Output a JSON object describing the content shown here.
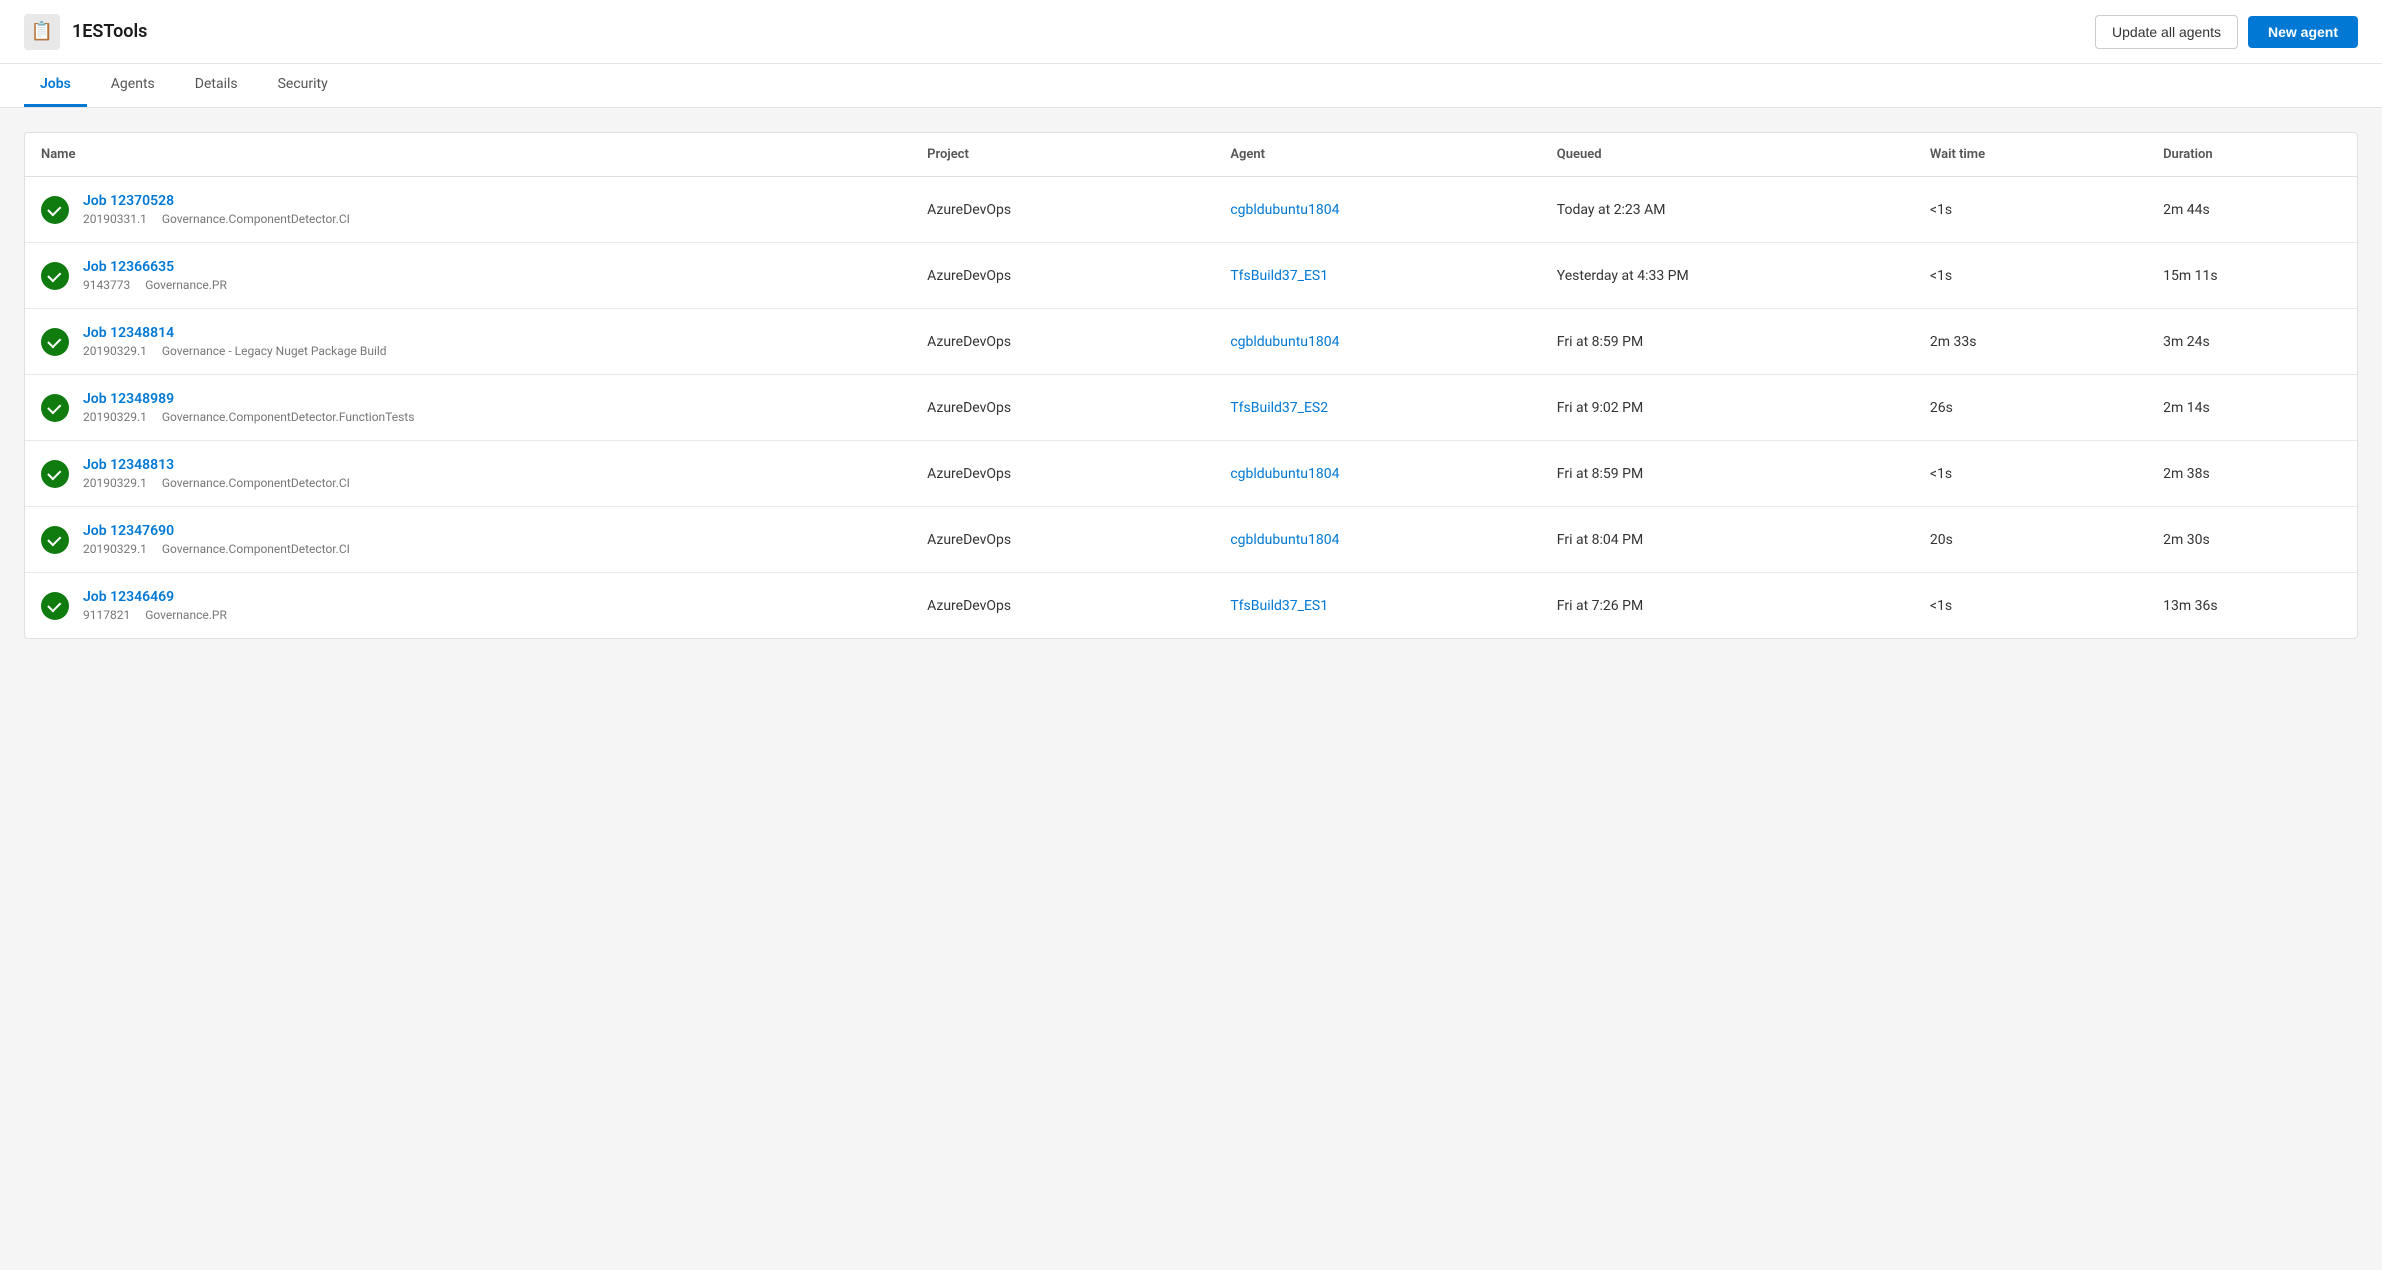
{
  "header": {
    "app_icon": "📋",
    "app_title": "1ESTools",
    "update_agents_label": "Update all agents",
    "new_agent_label": "New agent"
  },
  "tabs": [
    {
      "id": "jobs",
      "label": "Jobs",
      "active": true
    },
    {
      "id": "agents",
      "label": "Agents",
      "active": false
    },
    {
      "id": "details",
      "label": "Details",
      "active": false
    },
    {
      "id": "security",
      "label": "Security",
      "active": false
    }
  ],
  "table": {
    "columns": [
      {
        "id": "name",
        "label": "Name"
      },
      {
        "id": "project",
        "label": "Project"
      },
      {
        "id": "agent",
        "label": "Agent"
      },
      {
        "id": "queued",
        "label": "Queued"
      },
      {
        "id": "wait_time",
        "label": "Wait time"
      },
      {
        "id": "duration",
        "label": "Duration"
      }
    ],
    "rows": [
      {
        "status": "success",
        "job_name": "Job 12370528",
        "job_id": "20190331.1",
        "job_pipeline": "Governance.ComponentDetector.CI",
        "project": "AzureDevOps",
        "agent": "cgbldubuntu1804",
        "queued": "Today at 2:23 AM",
        "wait_time": "<1s",
        "duration": "2m 44s"
      },
      {
        "status": "success",
        "job_name": "Job 12366635",
        "job_id": "9143773",
        "job_pipeline": "Governance.PR",
        "project": "AzureDevOps",
        "agent": "TfsBuild37_ES1",
        "queued": "Yesterday at 4:33 PM",
        "wait_time": "<1s",
        "duration": "15m 11s"
      },
      {
        "status": "success",
        "job_name": "Job 12348814",
        "job_id": "20190329.1",
        "job_pipeline": "Governance - Legacy Nuget Package Build",
        "project": "AzureDevOps",
        "agent": "cgbldubuntu1804",
        "queued": "Fri at 8:59 PM",
        "wait_time": "2m 33s",
        "duration": "3m 24s"
      },
      {
        "status": "success",
        "job_name": "Job 12348989",
        "job_id": "20190329.1",
        "job_pipeline": "Governance.ComponentDetector.FunctionTests",
        "project": "AzureDevOps",
        "agent": "TfsBuild37_ES2",
        "queued": "Fri at 9:02 PM",
        "wait_time": "26s",
        "duration": "2m 14s"
      },
      {
        "status": "success",
        "job_name": "Job 12348813",
        "job_id": "20190329.1",
        "job_pipeline": "Governance.ComponentDetector.CI",
        "project": "AzureDevOps",
        "agent": "cgbldubuntu1804",
        "queued": "Fri at 8:59 PM",
        "wait_time": "<1s",
        "duration": "2m 38s"
      },
      {
        "status": "success",
        "job_name": "Job 12347690",
        "job_id": "20190329.1",
        "job_pipeline": "Governance.ComponentDetector.CI",
        "project": "AzureDevOps",
        "agent": "cgbldubuntu1804",
        "queued": "Fri at 8:04 PM",
        "wait_time": "20s",
        "duration": "2m 30s"
      },
      {
        "status": "success",
        "job_name": "Job 12346469",
        "job_id": "9117821",
        "job_pipeline": "Governance.PR",
        "project": "AzureDevOps",
        "agent": "TfsBuild37_ES1",
        "queued": "Fri at 7:26 PM",
        "wait_time": "<1s",
        "duration": "13m 36s"
      }
    ]
  }
}
